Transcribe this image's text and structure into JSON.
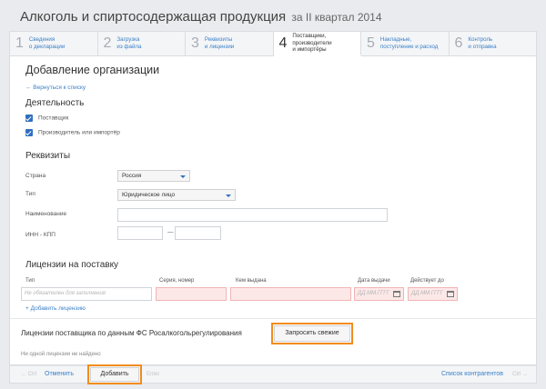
{
  "header": {
    "title": "Алкоголь и спиртосодержащая продукция",
    "period": "за II квартал 2014"
  },
  "steps": [
    {
      "num": "1",
      "label": "Сведения\nо декларации",
      "active": false
    },
    {
      "num": "2",
      "label": "Загрузка\nиз файла",
      "active": false
    },
    {
      "num": "3",
      "label": "Реквизиты\nи лицензии",
      "active": false
    },
    {
      "num": "4",
      "label": "Поставщики, производители\nи импортёры",
      "active": true
    },
    {
      "num": "5",
      "label": "Накладные,\nпоступление и расход",
      "active": false
    },
    {
      "num": "6",
      "label": "Контроль\nи отправка",
      "active": false
    }
  ],
  "form": {
    "title": "Добавление организации",
    "back_link": "← Вернуться к списку",
    "activity": {
      "heading": "Деятельность",
      "supplier_label": "Поставщик",
      "producer_label": "Производитель или импортёр"
    },
    "requisites": {
      "heading": "Реквизиты",
      "country_label": "Страна",
      "country_value": "Россия",
      "type_label": "Тип",
      "type_value": "Юридическое лицо",
      "name_label": "Наименование",
      "inn_label": "ИНН - КПП",
      "inn_separator": "—"
    },
    "licenses": {
      "heading": "Лицензии на поставку",
      "col_type": "Тип",
      "col_series": "Серия, номер",
      "col_issued_by": "Кем выдана",
      "col_date_issued": "Дата выдачи",
      "col_valid_until": "Действует до",
      "type_placeholder": "Не обязателен для заполнения",
      "date_placeholder": "ДД.ММ.ГГГГ",
      "add_link": "+ Добавить лицензию"
    },
    "fsrar": {
      "heading": "Лицензии поставщика по данным ФС Росалкогольрегулирования",
      "request_button": "Запросить свежие",
      "empty_text": "Ни одной лицензии не найдено"
    }
  },
  "footer": {
    "prev_muted": "← Ctrl",
    "cancel_label": "Отменить",
    "add_label": "Добавить",
    "add_shortcut": "Enter",
    "list_label": "Список контрагентов",
    "next_muted": "Ctrl →"
  },
  "colors": {
    "accent": "#3a80c7",
    "highlight": "#f28c1c",
    "error_bg": "#fde8e8"
  }
}
